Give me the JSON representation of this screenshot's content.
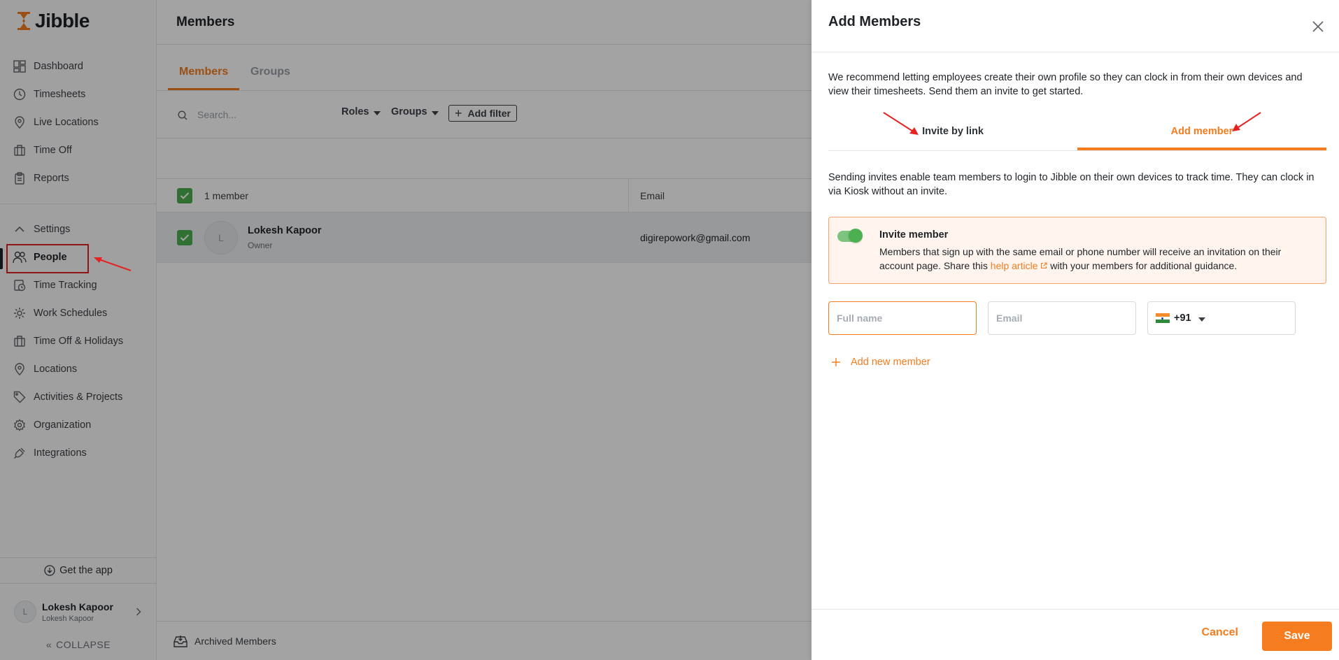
{
  "app": {
    "name": "Jibble"
  },
  "colors": {
    "accent": "#f57c1f",
    "success": "#4caf50",
    "annotation": "#e52222"
  },
  "sidebar": {
    "items": [
      {
        "label": "Dashboard",
        "icon": "dashboard-icon"
      },
      {
        "label": "Timesheets",
        "icon": "clock-icon"
      },
      {
        "label": "Live Locations",
        "icon": "location-pin-icon"
      },
      {
        "label": "Time Off",
        "icon": "luggage-icon"
      },
      {
        "label": "Reports",
        "icon": "clipboard-icon"
      }
    ],
    "settings": {
      "label": "Settings",
      "icon": "chevron-up-icon"
    },
    "settings_items": [
      {
        "label": "People",
        "icon": "people-icon"
      },
      {
        "label": "Time Tracking",
        "icon": "time-tracking-icon"
      },
      {
        "label": "Work Schedules",
        "icon": "gear-schedule-icon"
      },
      {
        "label": "Time Off & Holidays",
        "icon": "luggage-icon"
      },
      {
        "label": "Locations",
        "icon": "location-pin-icon"
      },
      {
        "label": "Activities & Projects",
        "icon": "tag-icon"
      },
      {
        "label": "Organization",
        "icon": "gear-icon"
      },
      {
        "label": "Integrations",
        "icon": "plug-icon"
      }
    ],
    "get_app": "Get the app",
    "user": {
      "initial": "L",
      "name": "Lokesh Kapoor",
      "role": "Lokesh Kapoor"
    },
    "collapse": "COLLAPSE"
  },
  "main": {
    "title": "Members",
    "tabs": [
      {
        "label": "Members"
      },
      {
        "label": "Groups"
      }
    ],
    "search_placeholder": "Search...",
    "filters": {
      "roles": "Roles",
      "groups": "Groups",
      "add_filter": "Add filter"
    },
    "table": {
      "count_label": "1 member",
      "email_header": "Email",
      "rows": [
        {
          "initial": "L",
          "name": "Lokesh Kapoor",
          "role": "Owner",
          "email": "digirepowork@gmail.com"
        }
      ]
    },
    "archived": "Archived Members"
  },
  "panel": {
    "title": "Add Members",
    "intro": "We recommend letting employees create their own profile so they can clock in from their own devices and view their timesheets. Send them an invite to get started.",
    "tabs": {
      "invite_by_link": "Invite by link",
      "add_member": "Add member"
    },
    "send_text": "Sending invites enable team members to login to Jibble on their own devices to track time. They can clock in via Kiosk without an invite.",
    "invite": {
      "title": "Invite member",
      "desc_before": "Members that sign up with the same email or phone number will receive an invitation on their account page. Share this",
      "link": "help article",
      "desc_after": "with your members for additional guidance.",
      "enabled": true
    },
    "fields": {
      "full_name_placeholder": "Full name",
      "email_placeholder": "Email",
      "phone_code": "+91",
      "country_flag": "india-flag-icon"
    },
    "add_new": "Add new member",
    "cancel": "Cancel",
    "save": "Save"
  }
}
